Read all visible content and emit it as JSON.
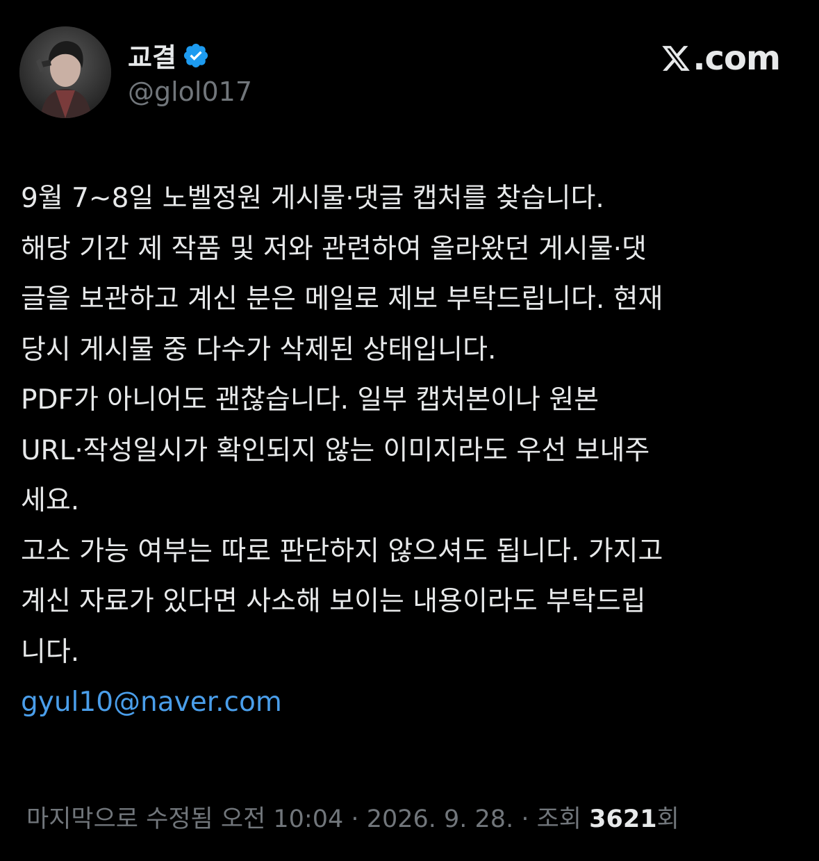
{
  "author": {
    "display_name": "교결",
    "handle": "@glol017",
    "verified": true,
    "avatar_icon": "avatar-portrait-icon"
  },
  "brand": {
    "label": ".com",
    "icon": "x-logo-icon"
  },
  "tweet": {
    "lines": [
      "9월 7~8일 노벨정원 게시물·댓글 캡처를 찾습니다.",
      "해당 기간 제 작품 및 저와 관련하여 올라왔던 게시물·댓",
      "글을 보관하고 계신 분은 메일로 제보 부탁드립니다. 현재",
      "당시 게시물 중 다수가 삭제된 상태입니다.",
      "PDF가 아니어도 괜찮습니다. 일부 캡처본이나 원본",
      "URL·작성일시가 확인되지 않는 이미지라도 우선 보내주",
      "세요.",
      "고소 가능 여부는 따로 판단하지 않으셔도 됩니다. 가지고",
      "계신 자료가 있다면 사소해 보이는 내용이라도 부탁드립",
      "니다."
    ],
    "email": "gyul10@naver.com"
  },
  "meta": {
    "edited_label": "마지막으로 수정됨",
    "time": "오전 10:04",
    "separator": "·",
    "date": "2026. 9. 28.",
    "views_prefix": "· 조회",
    "views_count": "3621",
    "views_suffix": "회"
  },
  "colors": {
    "background": "#000000",
    "text": "#e7e9ea",
    "secondary": "#71767b",
    "link": "#4a9eea",
    "verified": "#1d9bf0"
  }
}
